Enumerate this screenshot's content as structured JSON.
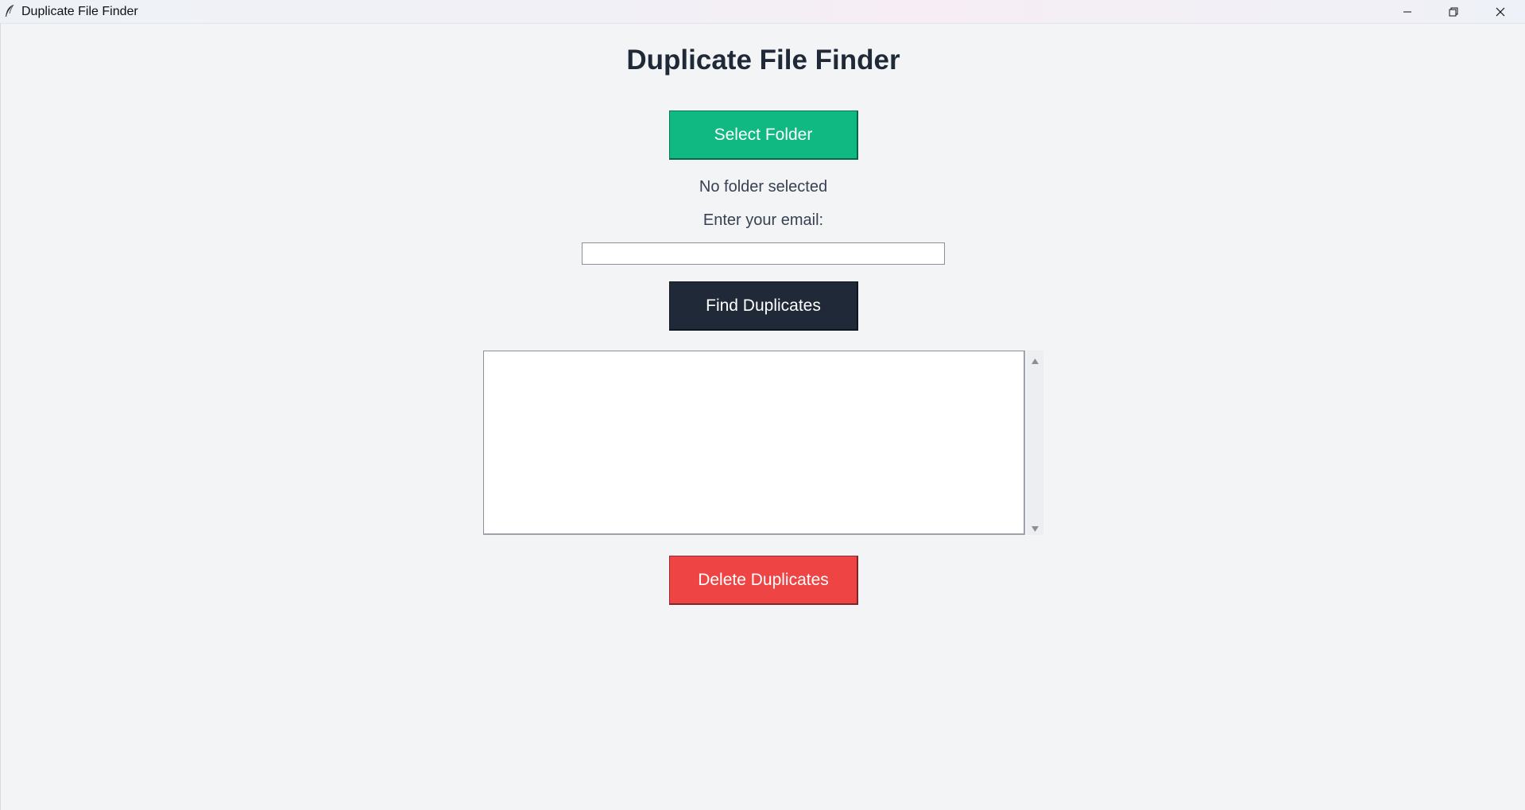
{
  "window": {
    "title": "Duplicate File Finder",
    "icon": "feather-icon",
    "controls": [
      "minimize-icon",
      "restore-icon",
      "close-icon"
    ]
  },
  "app": {
    "heading": "Duplicate File Finder",
    "select_folder_label": "Select Folder",
    "folder_status": "No folder selected",
    "email_label": "Enter your email:",
    "email_value": "",
    "find_label": "Find Duplicates",
    "results_text": "",
    "delete_label": "Delete Duplicates"
  },
  "colors": {
    "background": "#f3f4f6",
    "heading": "#1f2937",
    "select_button": "#10b981",
    "find_button": "#1f2937",
    "delete_button": "#ef4444",
    "button_text": "#ffffff"
  }
}
